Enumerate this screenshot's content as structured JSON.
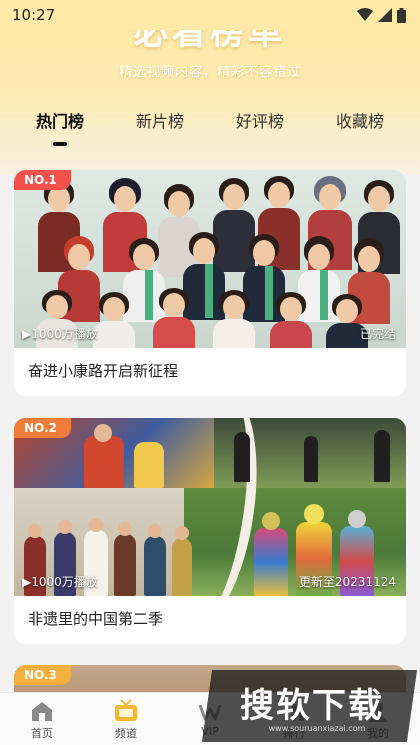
{
  "status_bar": {
    "time": "10:27"
  },
  "hero": {
    "title": "必看榜单",
    "subtitle": "精选视频内容，精彩不容错过"
  },
  "tabs": [
    {
      "label": "热门榜",
      "active": true
    },
    {
      "label": "新片榜",
      "active": false
    },
    {
      "label": "好评榜",
      "active": false
    },
    {
      "label": "收藏榜",
      "active": false
    }
  ],
  "cards": [
    {
      "rank": "NO.1",
      "plays": "▶1000万播放",
      "status": "已完结",
      "title": "奋进小康路开启新征程"
    },
    {
      "rank": "NO.2",
      "plays": "▶1000万播放",
      "status": "更新至20231124",
      "title": "非遗里的中国第二季"
    },
    {
      "rank": "NO.3"
    }
  ],
  "bottom_nav": [
    {
      "label": "首页",
      "icon": "home-icon"
    },
    {
      "label": "频道",
      "icon": "tv-icon"
    },
    {
      "label": "VIP",
      "icon": "vip-icon"
    },
    {
      "label": "排行",
      "icon": "rank-icon"
    },
    {
      "label": "我的",
      "icon": "user-icon"
    }
  ],
  "watermark": {
    "text": "搜软下载",
    "sub": "www.souruanxiazai.com"
  },
  "colors": {
    "hero_yellow": "#fde7a0",
    "rank_1": "#f2504b",
    "rank_2": "#f07c3a",
    "rank_3": "#f4b03d"
  }
}
